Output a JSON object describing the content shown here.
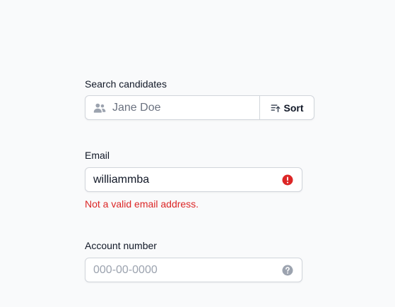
{
  "search": {
    "label": "Search candidates",
    "placeholder": "Jane Doe",
    "value": "",
    "sort_label": "Sort",
    "icon": "users-icon",
    "sort_icon": "sort-ascending-icon"
  },
  "email": {
    "label": "Email",
    "value": "williammba",
    "error": "Not a valid email address.",
    "icon": "exclamation-circle-icon",
    "error_color": "#dc2626"
  },
  "account": {
    "label": "Account number",
    "placeholder": "000-00-0000",
    "value": "",
    "icon": "question-circle-icon"
  }
}
